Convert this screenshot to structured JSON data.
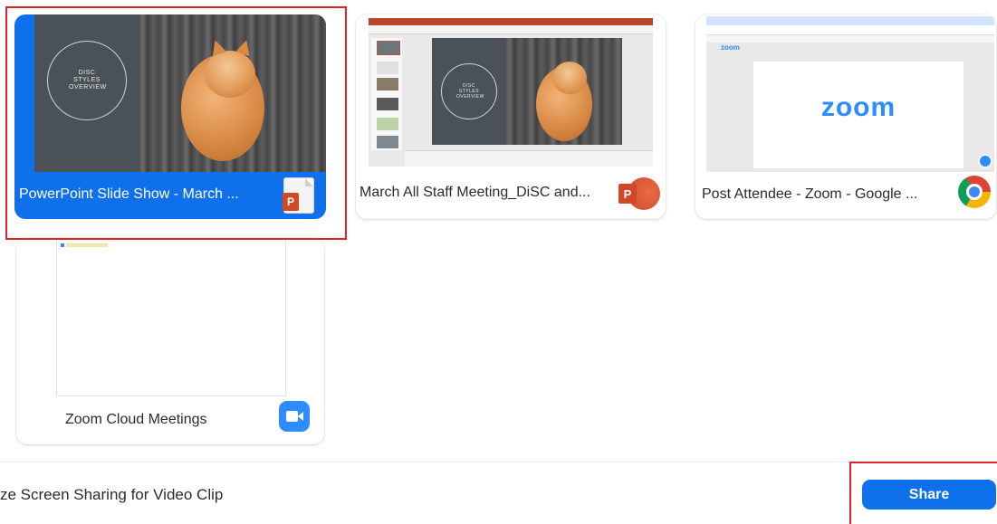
{
  "share_windows": [
    {
      "caption": "PowerPoint Slide Show  -  March ...",
      "app": "PowerPoint",
      "icon": "powerpoint-document-icon",
      "selected": true,
      "slide_circle_text": "DISC STYLES OVERVIEW"
    },
    {
      "caption": "March All Staff Meeting_DiSC and...",
      "app": "PowerPoint",
      "icon": "powerpoint-icon",
      "selected": false,
      "slide_circle_text": "DISC STYLES OVERVIEW"
    },
    {
      "caption": "Post Attendee - Zoom - Google ...",
      "app": "Google Chrome",
      "icon": "chrome-icon",
      "selected": false,
      "thumb_logo": "zoom",
      "thumb_nav_logo": "zoom"
    },
    {
      "caption": "Zoom Cloud Meetings",
      "app": "Zoom",
      "icon": "zoom-video-icon",
      "selected": false
    }
  ],
  "footer": {
    "option_label": "ze Screen Sharing for Video Clip",
    "share_label": "Share"
  },
  "colors": {
    "accent": "#0e71eb",
    "annotation": "#d9252b",
    "powerpoint": "#d24726",
    "zoom_logo": "#2d8cff"
  }
}
